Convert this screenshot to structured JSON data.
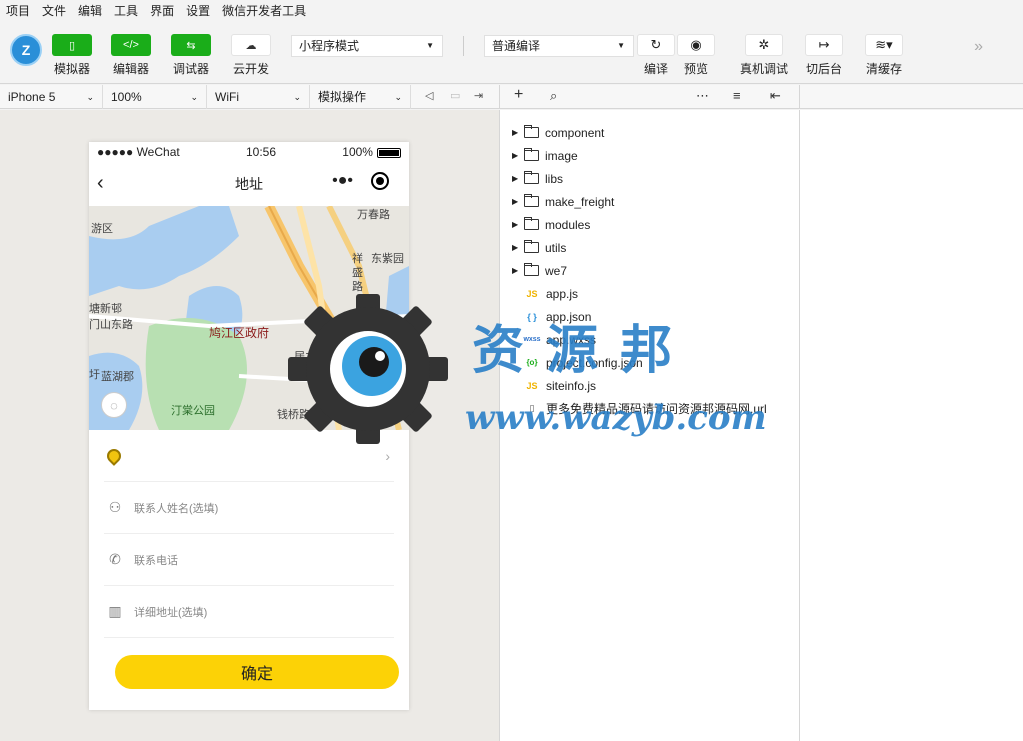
{
  "menu": [
    "项目",
    "文件",
    "编辑",
    "工具",
    "界面",
    "设置",
    "微信开发者工具"
  ],
  "toolbar": {
    "logo_text": "Z",
    "simulator": "模拟器",
    "editor": "编辑器",
    "debugger": "调试器",
    "cloud": "云开发",
    "mode_select": "小程序模式",
    "compile_select": "普通编译",
    "compile": "编译",
    "preview": "预览",
    "real_debug": "真机调试",
    "background": "切后台",
    "clear_cache": "清缓存"
  },
  "subbar": {
    "device": "iPhone 5",
    "zoom": "100%",
    "network": "WiFi",
    "operation": "模拟操作"
  },
  "phone": {
    "carrier": "●●●●● WeChat",
    "time": "10:56",
    "battery": "100%",
    "title": "地址",
    "capsule_dots": "•●•",
    "map_labels": [
      "游区",
      "万春路",
      "东紫园",
      "祥",
      "盛",
      "路",
      "塘新邨",
      "门山东路",
      "鸠江区政府",
      "蓝湖郡",
      "汀棠公园",
      "居之家",
      "钱桥路",
      "圩"
    ],
    "contact_name": "联系人姓名(选填)",
    "contact_phone": "联系电话",
    "address_detail": "详细地址(选填)",
    "confirm": "确定"
  },
  "tree": {
    "folders": [
      "component",
      "image",
      "libs",
      "make_freight",
      "modules",
      "utils",
      "we7"
    ],
    "files": [
      {
        "type": "JS",
        "name": "app.js"
      },
      {
        "type": "{ }",
        "name": "app.json"
      },
      {
        "type": "wxss",
        "name": "app.wxss"
      },
      {
        "type": "{o}",
        "name": "project.config.json"
      },
      {
        "type": "JS",
        "name": "siteinfo.js"
      },
      {
        "type": "▯",
        "name": "更多免费精品源码请访问资源邦源码网.url"
      }
    ]
  },
  "watermark": {
    "title": "资源邦",
    "url": "www.wazyb.com"
  }
}
